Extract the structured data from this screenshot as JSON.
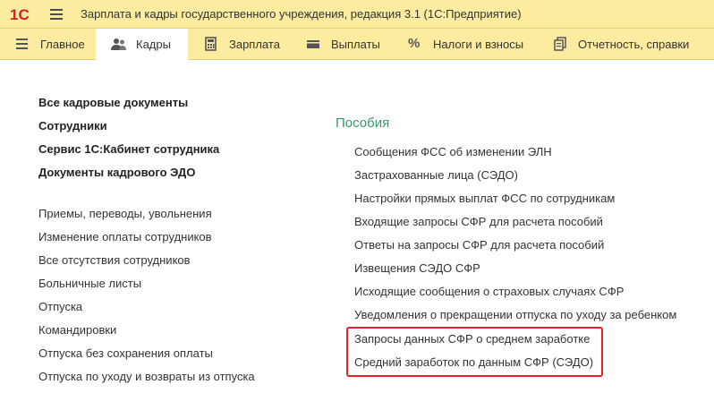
{
  "window": {
    "title": "Зарплата и кадры государственного учреждения, редакция 3.1  (1С:Предприятие)",
    "logo_text": "1С"
  },
  "colors": {
    "panel_bg": "#fbeca0",
    "accent_group": "#339966",
    "highlight": "#e8202a"
  },
  "sections": [
    {
      "label": "Главное",
      "icon": "list-icon",
      "active": false
    },
    {
      "label": "Кадры",
      "icon": "people-icon",
      "active": true
    },
    {
      "label": "Зарплата",
      "icon": "calculator-icon",
      "active": false
    },
    {
      "label": "Выплаты",
      "icon": "wallet-icon",
      "active": false
    },
    {
      "label": "Налоги и взносы",
      "icon": "percent-icon",
      "active": false
    },
    {
      "label": "Отчетность, справки",
      "icon": "documents-icon",
      "active": false
    }
  ],
  "left_column": {
    "bold_links": [
      "Все кадровые документы",
      "Сотрудники",
      "Сервис 1С:Кабинет сотрудника",
      "Документы кадрового ЭДО"
    ],
    "links": [
      "Приемы, переводы, увольнения",
      "Изменение оплаты сотрудников",
      "Все отсутствия сотрудников",
      "Больничные листы",
      "Отпуска",
      "Командировки",
      "Отпуска без сохранения оплаты",
      "Отпуска по уходу и возвраты из отпуска"
    ]
  },
  "right_column": {
    "group_title": "Пособия",
    "links": [
      "Сообщения ФСС об изменении ЭЛН",
      "Застрахованные лица (СЭДО)",
      "Настройки прямых выплат ФСС по сотрудникам",
      "Входящие запросы СФР для расчета пособий",
      "Ответы на запросы СФР для расчета пособий",
      "Извещения СЭДО СФР",
      "Исходящие сообщения о страховых случаях СФР",
      "Уведомления о прекращении отпуска по уходу за ребенком",
      "Запросы данных СФР о среднем заработке",
      "Средний заработок по данным СФР (СЭДО)"
    ]
  }
}
